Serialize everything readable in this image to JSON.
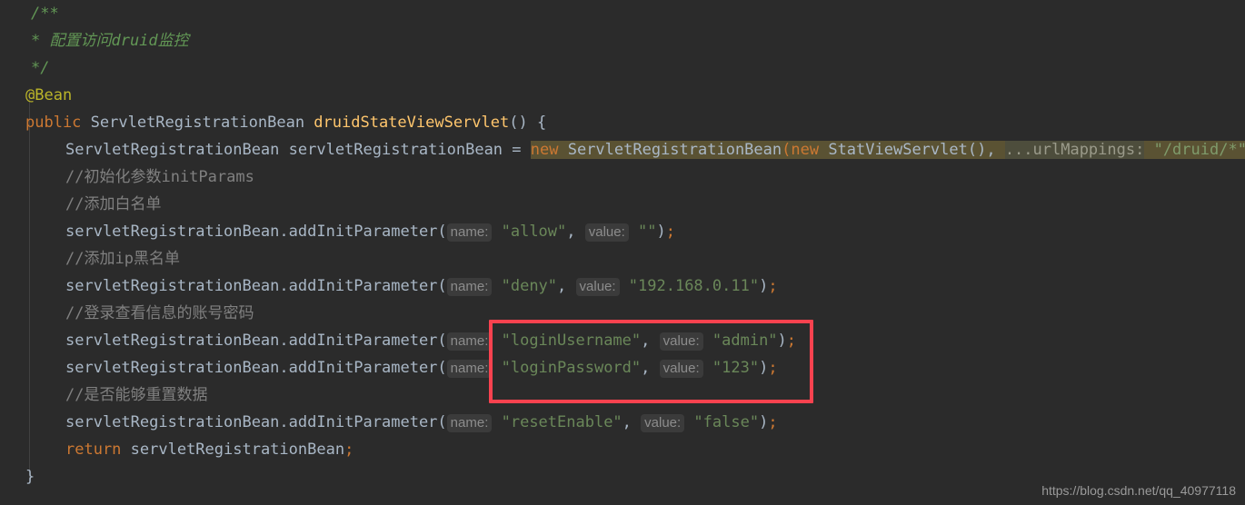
{
  "editor": {
    "background_color": "#2b2b2b",
    "theme_name": "darcula",
    "lines": [
      {
        "indent": "doc",
        "tokens": [
          {
            "cls": "t-doc",
            "text": "/**"
          }
        ]
      },
      {
        "indent": "doc",
        "tokens": [
          {
            "cls": "t-doc",
            "text": "* 配置访问druid监控"
          }
        ]
      },
      {
        "indent": "doc",
        "tokens": [
          {
            "cls": "t-doc",
            "text": "*/"
          }
        ]
      },
      {
        "indent": "0",
        "tokens": [
          {
            "cls": "t-anno",
            "text": "@Bean"
          }
        ]
      },
      {
        "indent": "0",
        "tokens": [
          {
            "cls": "t-keyword",
            "text": "public "
          },
          {
            "cls": "t-class",
            "text": "ServletRegistrationBean "
          },
          {
            "cls": "t-method",
            "text": "druidStateViewServlet"
          },
          {
            "cls": "t-paren",
            "text": "() {"
          }
        ]
      },
      {
        "indent": "1",
        "selected": true,
        "tokens": [
          {
            "cls": "t-class",
            "text": "ServletRegistrationBean "
          },
          {
            "cls": "t-ident",
            "text": "servletRegistrationBean "
          },
          {
            "cls": "t-punct",
            "text": "= "
          },
          {
            "cls": "sel-start",
            "text": ""
          },
          {
            "cls": "t-keyword",
            "text": "new "
          },
          {
            "cls": "t-class",
            "text": "ServletRegistrationBean"
          },
          {
            "cls": "t-keyword",
            "text": "("
          },
          {
            "cls": "t-keyword",
            "text": "new "
          },
          {
            "cls": "t-class",
            "text": "StatViewServlet"
          },
          {
            "cls": "t-paren",
            "text": "(), "
          },
          {
            "cls": "hint-sel",
            "text": "...urlMappings:"
          },
          {
            "cls": "t-string",
            "text": " \"/druid/*\""
          },
          {
            "cls": "t-paren",
            "text": ")"
          },
          {
            "cls": "sel-end",
            "text": ""
          },
          {
            "cls": "t-semi",
            "text": ";"
          }
        ]
      },
      {
        "indent": "1",
        "tokens": [
          {
            "cls": "t-comment",
            "text": "//初始化参数initParams"
          }
        ]
      },
      {
        "indent": "1",
        "tokens": [
          {
            "cls": "t-comment",
            "text": "//添加白名单"
          }
        ]
      },
      {
        "indent": "1",
        "tokens": [
          {
            "cls": "t-ident",
            "text": "servletRegistrationBean"
          },
          {
            "cls": "t-punct",
            "text": "."
          },
          {
            "cls": "t-ident",
            "text": "addInitParameter"
          },
          {
            "cls": "t-paren",
            "text": "("
          },
          {
            "cls": "hint",
            "text": "name:"
          },
          {
            "cls": "t-string",
            "text": " \"allow\""
          },
          {
            "cls": "t-punct",
            "text": ", "
          },
          {
            "cls": "hint",
            "text": "value:"
          },
          {
            "cls": "t-string",
            "text": " \"\""
          },
          {
            "cls": "t-paren",
            "text": ")"
          },
          {
            "cls": "t-semi",
            "text": ";"
          }
        ]
      },
      {
        "indent": "1",
        "tokens": [
          {
            "cls": "t-comment",
            "text": "//添加ip黑名单"
          }
        ]
      },
      {
        "indent": "1",
        "tokens": [
          {
            "cls": "t-ident",
            "text": "servletRegistrationBean"
          },
          {
            "cls": "t-punct",
            "text": "."
          },
          {
            "cls": "t-ident",
            "text": "addInitParameter"
          },
          {
            "cls": "t-paren",
            "text": "("
          },
          {
            "cls": "hint",
            "text": "name:"
          },
          {
            "cls": "t-string",
            "text": " \"deny\""
          },
          {
            "cls": "t-punct",
            "text": ", "
          },
          {
            "cls": "hint",
            "text": "value:"
          },
          {
            "cls": "t-string",
            "text": " \"192.168.0.11\""
          },
          {
            "cls": "t-paren",
            "text": ")"
          },
          {
            "cls": "t-semi",
            "text": ";"
          }
        ]
      },
      {
        "indent": "1",
        "tokens": [
          {
            "cls": "t-comment",
            "text": "//登录查看信息的账号密码"
          }
        ]
      },
      {
        "indent": "1",
        "tokens": [
          {
            "cls": "t-ident",
            "text": "servletRegistrationBean"
          },
          {
            "cls": "t-punct",
            "text": "."
          },
          {
            "cls": "t-ident",
            "text": "addInitParameter"
          },
          {
            "cls": "t-paren",
            "text": "("
          },
          {
            "cls": "hint",
            "text": "name:"
          },
          {
            "cls": "t-string",
            "text": " \"loginUsername\""
          },
          {
            "cls": "t-punct",
            "text": ", "
          },
          {
            "cls": "hint",
            "text": "value:"
          },
          {
            "cls": "t-string",
            "text": " \"admin\""
          },
          {
            "cls": "t-paren",
            "text": ")"
          },
          {
            "cls": "t-semi",
            "text": ";"
          }
        ]
      },
      {
        "indent": "1",
        "tokens": [
          {
            "cls": "t-ident",
            "text": "servletRegistrationBean"
          },
          {
            "cls": "t-punct",
            "text": "."
          },
          {
            "cls": "t-ident",
            "text": "addInitParameter"
          },
          {
            "cls": "t-paren",
            "text": "("
          },
          {
            "cls": "hint",
            "text": "name:"
          },
          {
            "cls": "t-string",
            "text": " \"loginPassword\""
          },
          {
            "cls": "t-punct",
            "text": ", "
          },
          {
            "cls": "hint",
            "text": "value:"
          },
          {
            "cls": "t-string",
            "text": " \"123\""
          },
          {
            "cls": "t-paren",
            "text": ")"
          },
          {
            "cls": "t-semi",
            "text": ";"
          }
        ]
      },
      {
        "indent": "1",
        "tokens": [
          {
            "cls": "t-comment",
            "text": "//是否能够重置数据"
          }
        ]
      },
      {
        "indent": "1",
        "tokens": [
          {
            "cls": "t-ident",
            "text": "servletRegistrationBean"
          },
          {
            "cls": "t-punct",
            "text": "."
          },
          {
            "cls": "t-ident",
            "text": "addInitParameter"
          },
          {
            "cls": "t-paren",
            "text": "("
          },
          {
            "cls": "hint",
            "text": "name:"
          },
          {
            "cls": "t-string",
            "text": " \"resetEnable\""
          },
          {
            "cls": "t-punct",
            "text": ", "
          },
          {
            "cls": "hint",
            "text": "value:"
          },
          {
            "cls": "t-string",
            "text": " \"false\""
          },
          {
            "cls": "t-paren",
            "text": ")"
          },
          {
            "cls": "t-semi",
            "text": ";"
          }
        ]
      },
      {
        "indent": "1",
        "tokens": [
          {
            "cls": "t-keyword",
            "text": "return "
          },
          {
            "cls": "t-ident",
            "text": "servletRegistrationBean"
          },
          {
            "cls": "t-semi",
            "text": ";"
          }
        ]
      },
      {
        "indent": "0",
        "tokens": [
          {
            "cls": "t-paren",
            "text": "}"
          }
        ]
      }
    ]
  },
  "annotation": {
    "red_box_color": "#f9424f",
    "selection_color": "#5a5233"
  },
  "watermark": {
    "text": "https://blog.csdn.net/qq_40977118",
    "color": "#9a9a9a"
  }
}
